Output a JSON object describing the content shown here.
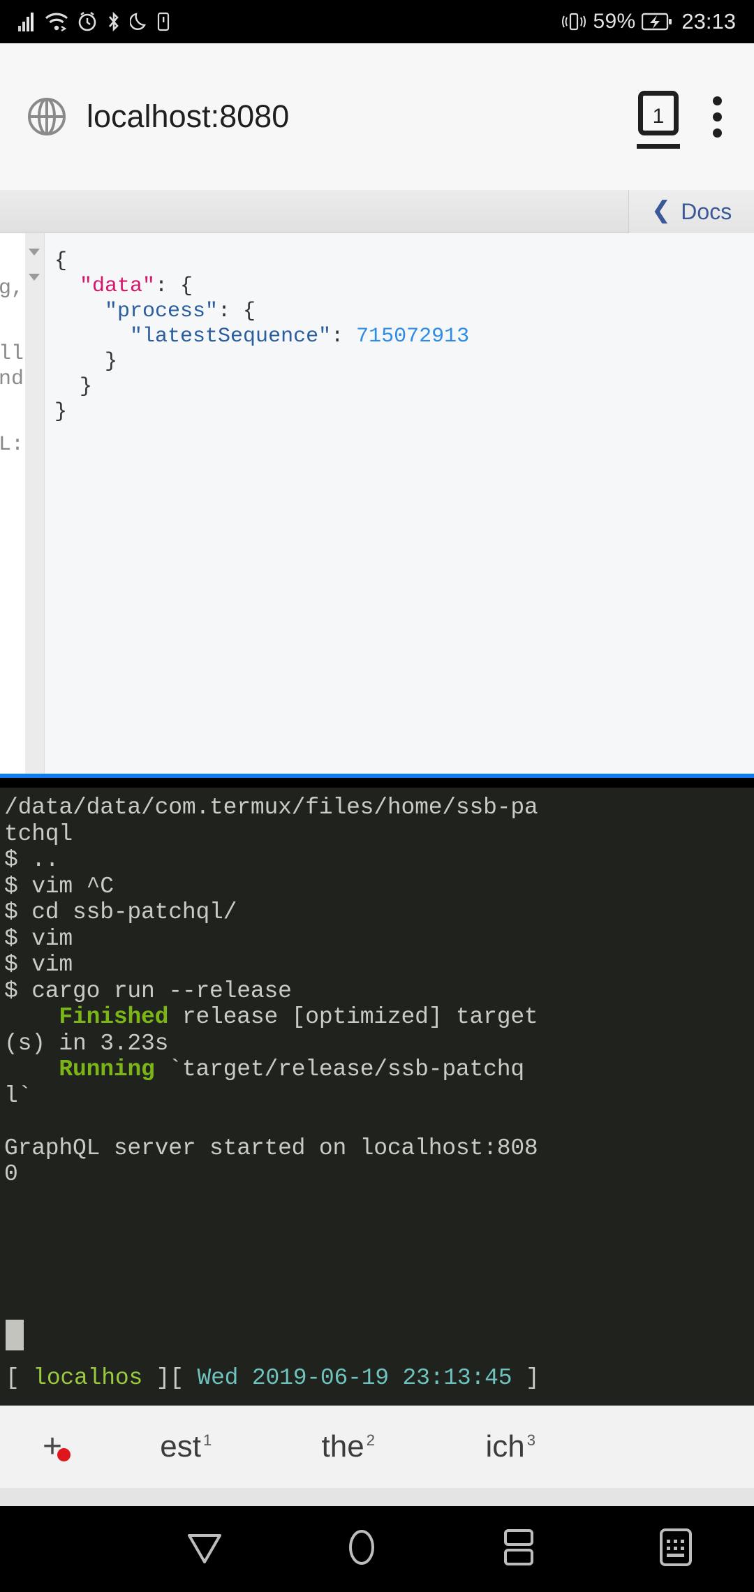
{
  "status_bar": {
    "icons_left": [
      "signal-icon",
      "wifi-icon",
      "alarm-icon",
      "bluetooth-icon",
      "do-not-disturb-icon",
      "sim-card-icon"
    ],
    "icons_right": [
      "vibrate-icon",
      "battery-icon"
    ],
    "battery_percent": "59%",
    "clock": "23:13"
  },
  "browser": {
    "site_icon": "globe-icon",
    "url": "localhost:8080",
    "tab_count": "1",
    "menu_icon": "kebab-menu-icon"
  },
  "graphiql": {
    "docs_button": {
      "chevron": "❮",
      "label": "Docs"
    },
    "query_fragments": [
      "g,",
      "ll",
      "nd",
      "L:"
    ],
    "result": {
      "line1": "{",
      "line2_key": "\"data\"",
      "line2_rest": ": {",
      "line3_key": "\"process\"",
      "line3_rest": ": {",
      "line4_key": "\"latestSequence\"",
      "line4_sep": ": ",
      "line4_value": "715072913",
      "line5": "}",
      "line6": "}",
      "line7": "}"
    }
  },
  "terminal": {
    "lines": [
      {
        "text": "/data/data/com.termux/files/home/ssb-pa"
      },
      {
        "text": "tchql"
      },
      {
        "text": "$ .."
      },
      {
        "text": "$ vim ^C"
      },
      {
        "text": "$ cd ssb-patchql/"
      },
      {
        "text": "$ vim"
      },
      {
        "text": "$ vim"
      },
      {
        "text": "$ cargo run --release"
      },
      {
        "prefix": "    ",
        "highlight": "Finished",
        "suffix": " release [optimized] target"
      },
      {
        "text": "(s) in 3.23s"
      },
      {
        "prefix": "    ",
        "highlight": "Running",
        "suffix": " `target/release/ssb-patchq"
      },
      {
        "text": "l`"
      },
      {
        "text": ""
      },
      {
        "text": "GraphQL server started on localhost:808"
      },
      {
        "text": "0"
      }
    ],
    "status_line": {
      "open1": "[ ",
      "host": "localhos",
      "close1": " ][ ",
      "datetime": "Wed 2019-06-19 23:13:45",
      "close2": " ]"
    }
  },
  "keyboard": {
    "add_label": "+",
    "suggestions": [
      {
        "word": "est",
        "index": "1"
      },
      {
        "word": "the",
        "index": "2"
      },
      {
        "word": "ich",
        "index": "3"
      }
    ]
  },
  "navigation": {
    "back_icon": "back-triangle-icon",
    "home_icon": "home-circle-icon",
    "recents_icon": "recents-icon",
    "keyboard_icon": "hide-keyboard-icon"
  },
  "colors": {
    "terminal_bg": "#1f221d",
    "accent_blue": "#117cee",
    "green": "#7cb518",
    "cyan": "#6fc3bf",
    "red_dot": "#e0161d"
  }
}
